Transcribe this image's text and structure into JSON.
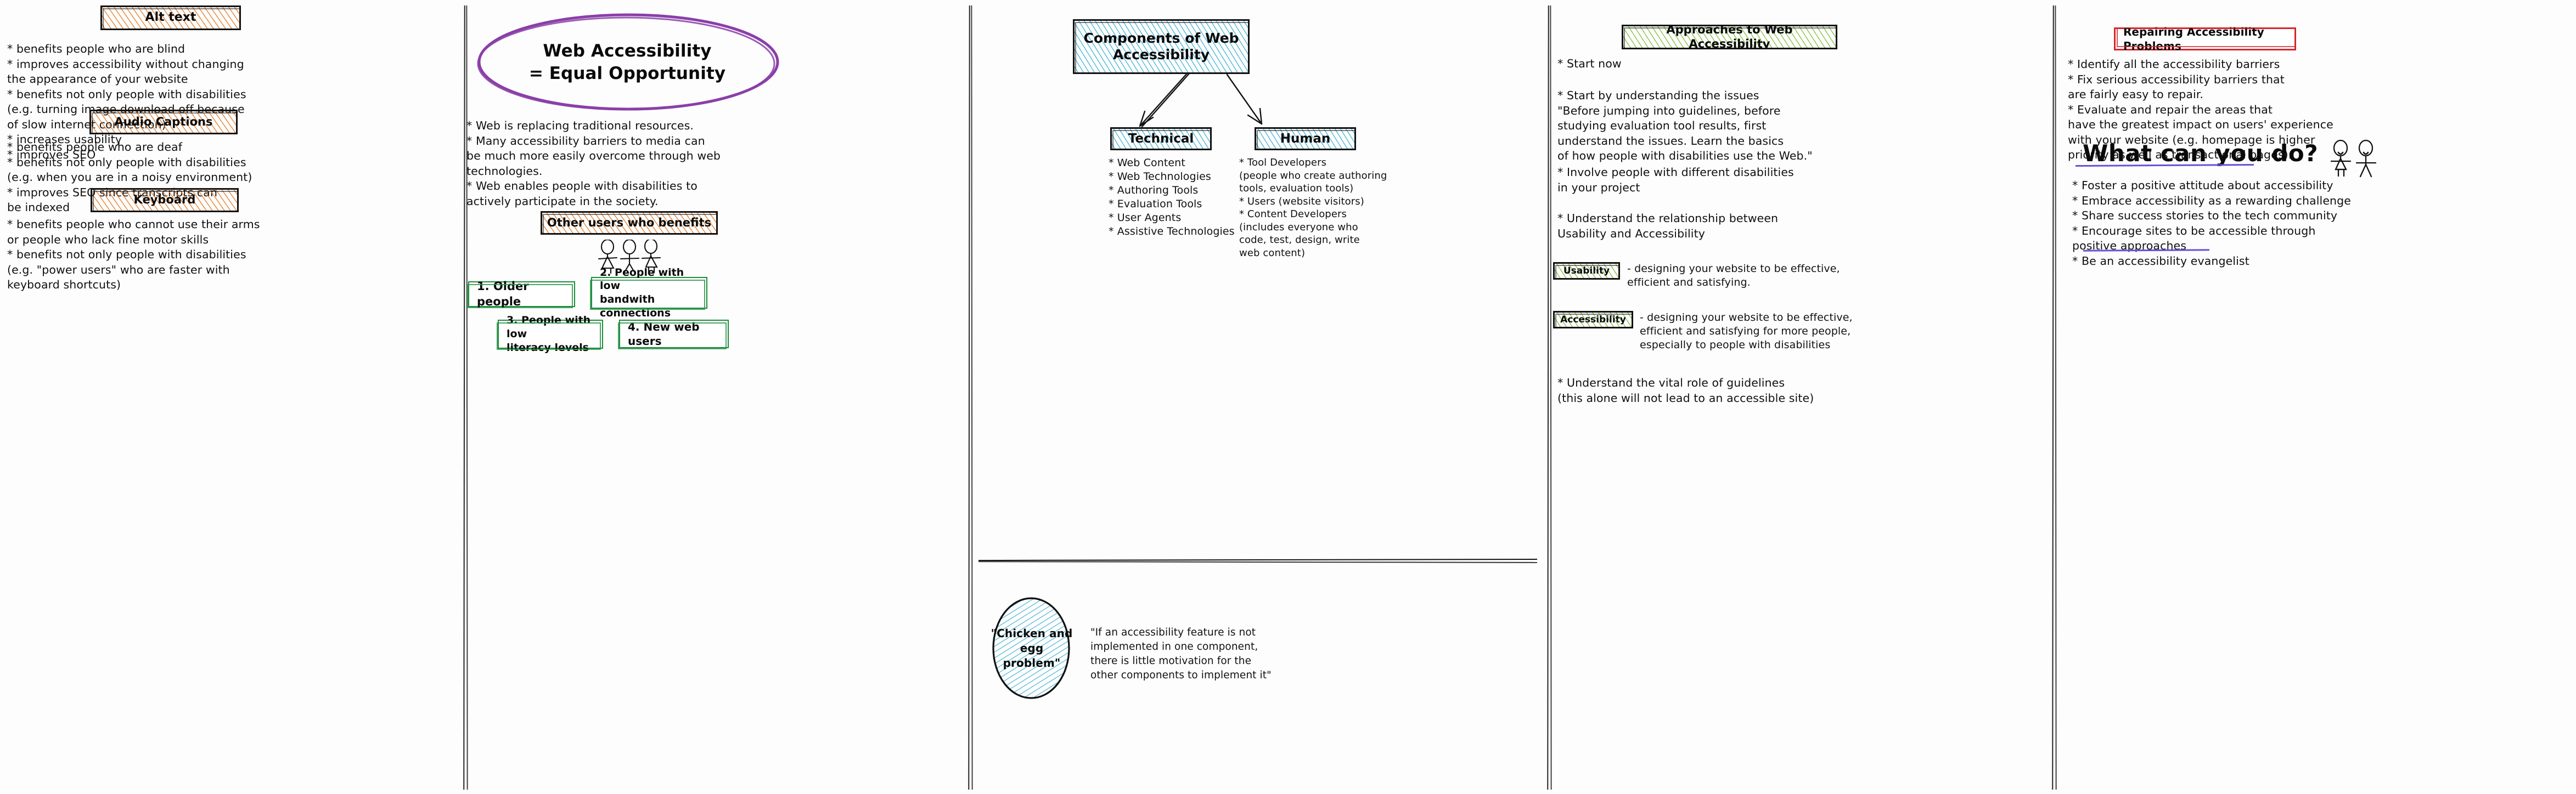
{
  "meta": {
    "palette": {
      "orange": "#e87d28",
      "blue": "#3cb0d4",
      "green": "#7cbd30",
      "green_border": "#1f8a3f",
      "purple": "#8a3fa8",
      "violet": "#6b4fd8",
      "red": "#d6262c",
      "ink": "#0b0b0b"
    }
  },
  "columns": [
    {
      "id": "alt-text-column",
      "sections": [
        {
          "heading": "Alt text",
          "heading_style": "orange-hatch",
          "bullets": "* benefits people who are blind\n* improves accessibility without changing\nthe appearance of your website\n* benefits not only people with disabilities\n(e.g. turning image download off because\nof slow internet connection)\n* increases usability\n* improves SEO"
        },
        {
          "heading": "Audio Captions",
          "heading_style": "orange-hatch",
          "bullets": "* benefits people who are deaf\n* benefits not only people with disabilities\n(e.g. when you are in a noisy environment)\n* improves SEO since transcripts can\nbe indexed"
        },
        {
          "heading": "Keyboard",
          "heading_style": "orange-hatch",
          "bullets": "* benefits people who cannot use their arms\nor people who lack fine motor skills\n* benefits not only people with disabilities\n(e.g. \"power users\" who are faster with\nkeyboard shortcuts)"
        }
      ]
    },
    {
      "id": "equal-opportunity-column",
      "ellipse_title": "Web Accessibility\n= Equal Opportunity",
      "ellipse_bullets": "* Web is replacing traditional resources.\n* Many accessibility barriers to media can\nbe much more easily overcome through web\ntechnologies.\n* Web enables people with disabilities to\nactively participate in the society.",
      "other_users_heading": "Other users who benefits",
      "other_users_heading_style": "orange-hatch",
      "figures_icon": "three-stick-figures-icon",
      "user_boxes": [
        {
          "label": "1. Older people"
        },
        {
          "label": "2. People with low\nbandwith connections"
        },
        {
          "label": "3. People with low\nliteracy levels"
        },
        {
          "label": "4. New web users"
        }
      ]
    },
    {
      "id": "components-column",
      "root_box": "Components of\nWeb Accessibility",
      "root_box_style": "blue-hatch",
      "branches": [
        {
          "label": "Technical",
          "label_style": "blue-hatch",
          "bullets": "* Web Content\n* Web Technologies\n* Authoring Tools\n* Evaluation Tools\n* User Agents\n* Assistive Technologies"
        },
        {
          "label": "Human",
          "label_style": "blue-hatch",
          "bullets": "* Tool Developers\n(people who create authoring\ntools, evaluation tools)\n* Users (website visitors)\n* Content Developers\n(includes everyone who\ncode, test, design, write\nweb content)"
        }
      ],
      "chicken_egg_blob": "\"Chicken and\negg problem\"",
      "chicken_egg_quote": "\"If an accessibility feature is not\nimplemented in one component,\nthere is little motivation for the\nother components to implement it\""
    },
    {
      "id": "approaches-column",
      "heading": "Approaches to Web Accessibility",
      "heading_style": "green-hatch",
      "bullet_1": "* Start now",
      "bullet_2": "* Start by understanding the issues\n\"Before jumping into guidelines, before\nstudying evaluation tool results, first\nunderstand the issues. Learn the basics\nof how people with disabilities use the Web.\"",
      "bullet_3": "* Involve people with different disabilities\nin your project",
      "bullet_4": "* Understand the relationship between\nUsability and Accessibility",
      "definitions": [
        {
          "term": "Usability",
          "term_style": "green-hatch",
          "definition": "- designing your website to be effective,\nefficient and satisfying."
        },
        {
          "term": "Accessibility",
          "term_style": "green-hatch",
          "definition": "- designing your website to be effective,\nefficient and satisfying for more people,\nespecially to people with disabilities"
        }
      ],
      "bullet_5": "* Understand the vital role of guidelines\n(this alone will not lead to an accessible site)"
    },
    {
      "id": "repairing-column",
      "heading": "Repairing Accessibility Problems",
      "heading_style": "red-outline",
      "bullets": "* Identify all the accessibility barriers\n* Fix serious accessibility barriers that\nare fairly easy to repair.\n* Evaluate and repair the areas that\nhave the greatest impact on users' experience\nwith your website (e.g. homepage is higher\npriority as well as transactional pages).",
      "cta_title": "What can you do?",
      "cta_figures_icon": "two-stick-figures-icon",
      "cta_bullets": "* Foster a positive attitude about accessibility\n* Embrace accessibility as a rewarding challenge\n* Share success stories to the tech community\n* Encourage sites to be accessible through\npositive approaches\n* Be an accessibility evangelist"
    }
  ]
}
